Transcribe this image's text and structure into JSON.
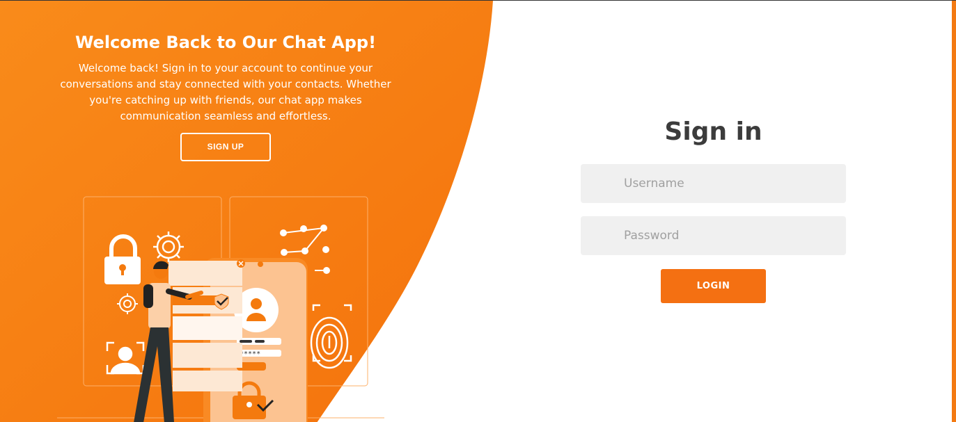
{
  "brand": {
    "orange": "#f47a0e",
    "orange_light": "#fb8a17",
    "text_dark": "#3c3c3c"
  },
  "welcome": {
    "title": "Welcome Back to Our Chat App!",
    "text": "Welcome back! Sign in to your account to continue your conversations and stay connected with your contacts. Whether you're catching up with friends, our chat app makes communication seamless and effortless.",
    "signup_label": "SIGN UP"
  },
  "signin": {
    "title": "Sign in",
    "username_placeholder": "Username",
    "password_placeholder": "Password",
    "login_label": "LOGIN"
  },
  "illustration": {
    "pin_mask": "*****",
    "icons": [
      "lock-icon",
      "gear-icon",
      "user-icon",
      "fingerprint-icon",
      "pattern-lock-icon",
      "face-id-icon",
      "checkmark-icon"
    ]
  }
}
